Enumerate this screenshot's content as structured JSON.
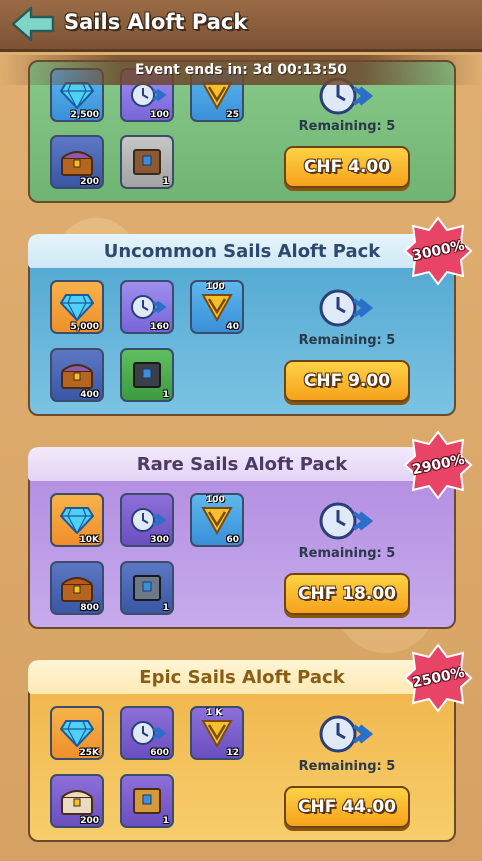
{
  "header": {
    "title": "Sails Aloft Pack",
    "back_icon": "back-arrow-icon"
  },
  "event": {
    "text": "Event ends in: 3d 00:13:50"
  },
  "packs": [
    {
      "title": "",
      "remaining": "Remaining: 5",
      "price": "CHF 4.00",
      "items": [
        {
          "icon": "diamond-icon",
          "count": "2,500"
        },
        {
          "icon": "speedup-clock-icon",
          "count": "100"
        },
        {
          "icon": "v-token-icon",
          "count": "25"
        },
        {
          "icon": "treasure-chest-icon",
          "count": "200"
        },
        {
          "icon": "crate-icon",
          "count": "1"
        }
      ]
    },
    {
      "title": "Uncommon Sails Aloft Pack",
      "badge": "3000%",
      "remaining": "Remaining: 5",
      "price": "CHF 9.00",
      "items": [
        {
          "icon": "diamond-icon",
          "count": "5,000"
        },
        {
          "icon": "speedup-clock-icon",
          "count": "160"
        },
        {
          "icon": "v-token-icon",
          "top": "100",
          "count": "40"
        },
        {
          "icon": "treasure-chest-icon",
          "count": "400"
        },
        {
          "icon": "crate-icon",
          "count": "1"
        }
      ]
    },
    {
      "title": "Rare Sails Aloft Pack",
      "badge": "2900%",
      "remaining": "Remaining: 5",
      "price": "CHF 18.00",
      "items": [
        {
          "icon": "diamond-icon",
          "count": "10K"
        },
        {
          "icon": "speedup-clock-icon",
          "count": "300"
        },
        {
          "icon": "v-token-icon",
          "top": "100",
          "count": "60"
        },
        {
          "icon": "treasure-chest-icon",
          "count": "800"
        },
        {
          "icon": "crate-icon",
          "count": "1"
        }
      ]
    },
    {
      "title": "Epic Sails Aloft Pack",
      "badge": "2500%",
      "remaining": "Remaining: 5",
      "price": "CHF 44.00",
      "items": [
        {
          "icon": "diamond-icon",
          "count": "25K"
        },
        {
          "icon": "speedup-clock-icon",
          "count": "600"
        },
        {
          "icon": "v-token-icon",
          "top": "1 K",
          "count": "12"
        },
        {
          "icon": "treasure-chest-icon",
          "count": "200"
        },
        {
          "icon": "crate-icon",
          "count": "1"
        }
      ]
    }
  ],
  "colors": {
    "badge": "#e84466",
    "button": "#f6a21b",
    "green_pack": "#6fb472",
    "blue_pack": "#4da5cf",
    "purple_pack": "#b08ae0",
    "gold_pack": "#f0b348"
  }
}
